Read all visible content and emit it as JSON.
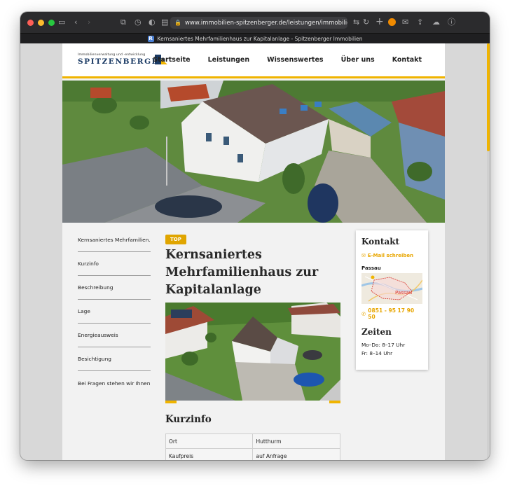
{
  "browser": {
    "url": "www.immobilien-spitzenberger.de/leistungen/immobilien-zur",
    "tab_title": "Kernsaniertes Mehrfamilienhaus zur Kapitalanlage - Spitzenberger Immobilien",
    "favicon_letter": "R"
  },
  "header": {
    "logo_small": "Immobilienverwaltung und -entwicklung",
    "logo_big": "SPITZENBERGER",
    "nav": [
      "Startseite",
      "Leistungen",
      "Wissenswertes",
      "Über uns",
      "Kontakt"
    ]
  },
  "sidebar": {
    "items": [
      "Kernsaniertes Mehrfamilien...",
      "Kurzinfo",
      "Beschreibung",
      "Lage",
      "Energieausweis",
      "Besichtigung",
      "Bei Fragen stehen wir Ihnen..."
    ]
  },
  "main": {
    "badge": "TOP",
    "title": "Kernsaniertes Mehrfamilienhaus zur Kapitalanlage",
    "kurzinfo_heading": "Kurzinfo",
    "table": [
      [
        "Ort",
        "Hutthurm"
      ],
      [
        "Kaufpreis",
        "auf Anfrage"
      ]
    ]
  },
  "contact": {
    "heading": "Kontakt",
    "email_label": "E-Mail schreiben",
    "city": "Passau",
    "map_label": "Passau",
    "phone": "0851 - 95 17 90 50",
    "hours_heading": "Zeiten",
    "hours_line1": "Mo–Do: 8–17 Uhr",
    "hours_line2": "Fr: 8–14 Uhr"
  },
  "colors": {
    "accent": "#f0b400",
    "brand_blue": "#1a3a64"
  }
}
